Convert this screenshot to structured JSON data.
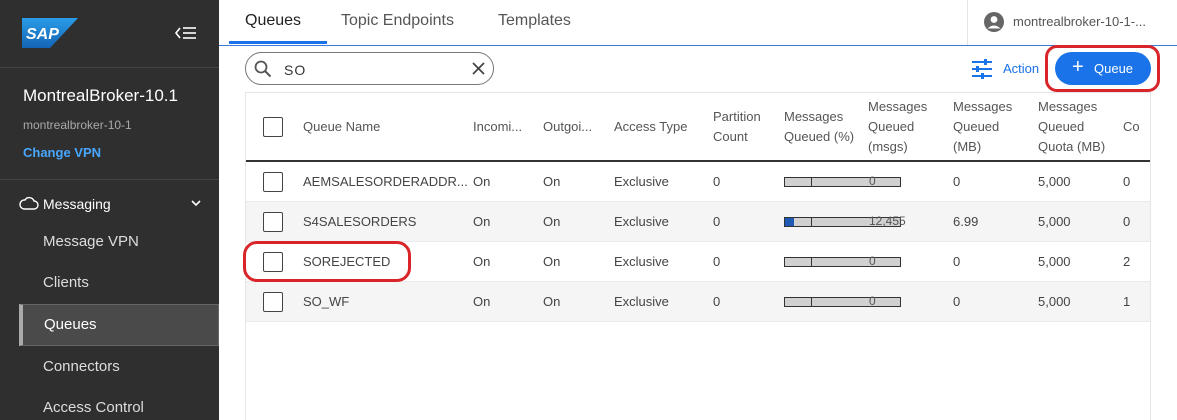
{
  "brand": {
    "logo_text": "SAP"
  },
  "broker": {
    "name": "MontrealBroker-10.1",
    "subname": "montrealbroker-10-1",
    "change_vpn": "Change VPN"
  },
  "sidebar": {
    "section": "Messaging",
    "items": [
      {
        "label": "Message VPN"
      },
      {
        "label": "Clients"
      },
      {
        "label": "Queues"
      },
      {
        "label": "Connectors"
      },
      {
        "label": "Access Control"
      }
    ]
  },
  "tabs": [
    "Queues",
    "Topic Endpoints",
    "Templates"
  ],
  "user": {
    "name": "montrealbroker-10-1-..."
  },
  "search": {
    "value": "SO"
  },
  "toolbar": {
    "action_label": "Action",
    "queue_label": "Queue"
  },
  "table": {
    "headers": {
      "name": "Queue Name",
      "incoming": "Incomi...",
      "outgoing": "Outgoi...",
      "access": "Access Type",
      "partition": [
        "Partition",
        "Count"
      ],
      "pct": [
        "Messages",
        "Queued (%)"
      ],
      "msgs": [
        "Messages",
        "Queued",
        "(msgs)"
      ],
      "mb": [
        "Messages",
        "Queued",
        "(MB)"
      ],
      "quota": [
        "Messages",
        "Queued",
        "Quota (MB)"
      ],
      "last": "Co"
    },
    "rows": [
      {
        "name": "AEMSALESORDERADDR...",
        "incoming": "On",
        "outgoing": "On",
        "access": "Exclusive",
        "partition": "0",
        "pct": 0,
        "msgs": "0",
        "mb": "0",
        "quota": "5,000",
        "last": "0"
      },
      {
        "name": "S4SALESORDERS",
        "incoming": "On",
        "outgoing": "On",
        "access": "Exclusive",
        "partition": "0",
        "pct": 8,
        "msgs": "12,455",
        "mb": "6.99",
        "quota": "5,000",
        "last": "0"
      },
      {
        "name": "SOREJECTED",
        "incoming": "On",
        "outgoing": "On",
        "access": "Exclusive",
        "partition": "0",
        "pct": 0,
        "msgs": "0",
        "mb": "0",
        "quota": "5,000",
        "last": "2"
      },
      {
        "name": "SO_WF",
        "incoming": "On",
        "outgoing": "On",
        "access": "Exclusive",
        "partition": "0",
        "pct": 0,
        "msgs": "0",
        "mb": "0",
        "quota": "5,000",
        "last": "1"
      }
    ]
  },
  "colors": {
    "accent": "#1a73e8",
    "sidebar": "#2f2f2f",
    "highlight": "#d9252a",
    "bar_fill": "#1f5bb5"
  }
}
